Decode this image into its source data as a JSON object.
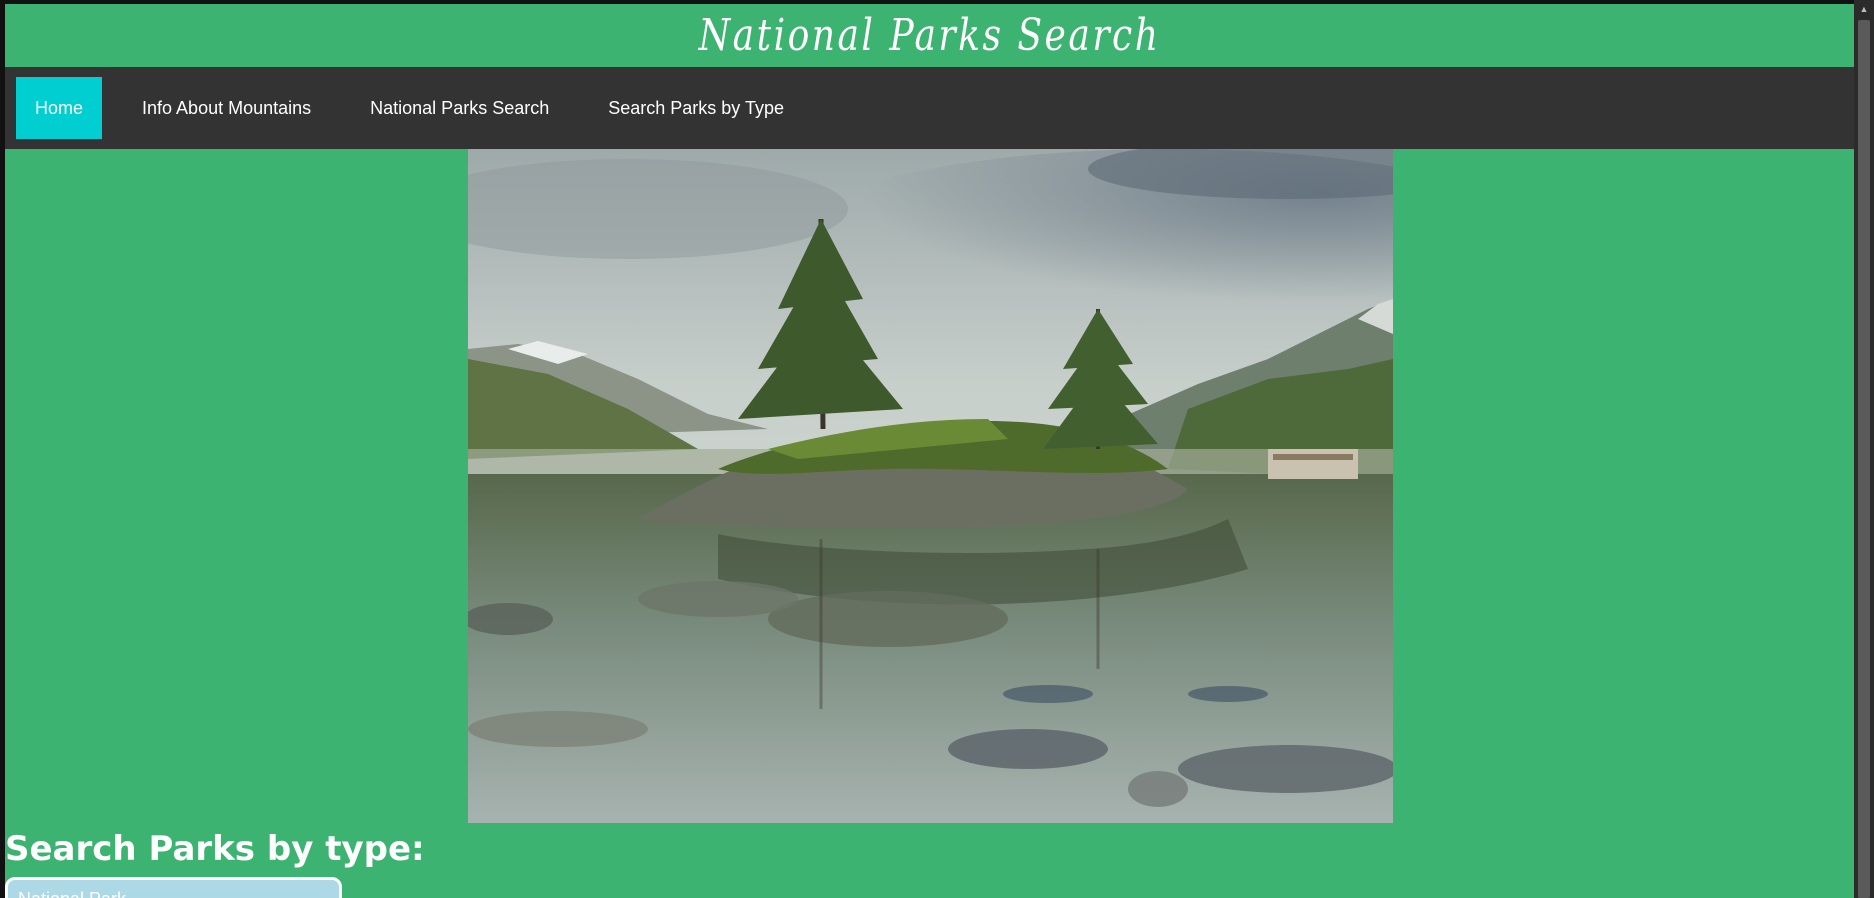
{
  "site": {
    "title": "National Parks Search"
  },
  "nav": {
    "items": [
      {
        "label": "Home",
        "active": true
      },
      {
        "label": "Info About Mountains",
        "active": false
      },
      {
        "label": "National Parks Search",
        "active": false
      },
      {
        "label": "Search Parks by Type",
        "active": false
      }
    ]
  },
  "hero": {
    "image_subject": "lake with small rocky island, two pine trees, mountains and cloudy sky"
  },
  "search": {
    "heading": "Search Parks by type:",
    "select_value": "National Park"
  },
  "colors": {
    "page_background": "#3cb371",
    "navbar_background": "#333333",
    "active_nav": "#00ced1",
    "select_background": "#add8e6"
  },
  "icons": {
    "select_caret": "chevron-down-icon",
    "scroll_up": "arrow-up-icon"
  }
}
